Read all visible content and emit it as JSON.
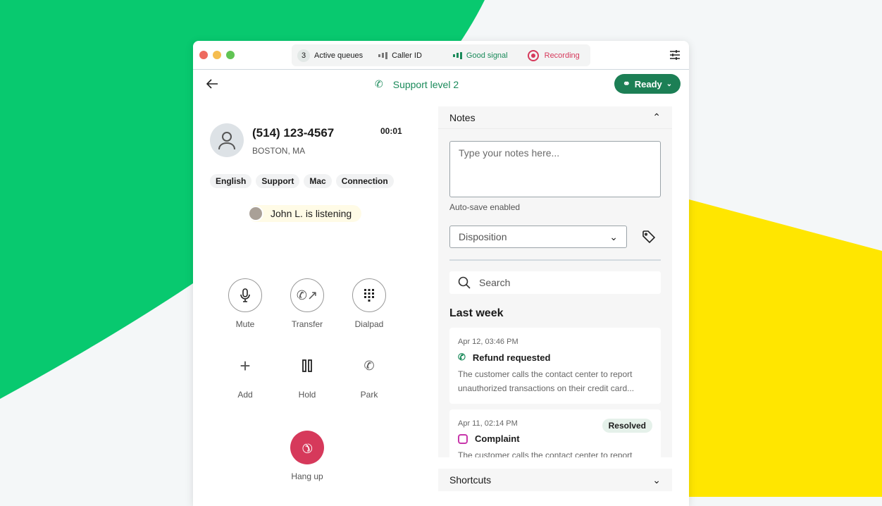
{
  "colors": {
    "brand_green": "#08c96f",
    "yellow": "#ffe600",
    "accent": "#1c7f55",
    "hangup": "#d6395b",
    "recording": "#d6395b"
  },
  "status_bar": {
    "queue_count": "3",
    "active_queues": "Active queues",
    "caller_id": "Caller ID",
    "signal": "Good signal",
    "recording": "Recording"
  },
  "header": {
    "queue_name": "Support level 2",
    "status": "Ready"
  },
  "caller": {
    "phone": "(514) 123-4567",
    "location": "BOSTON, MA",
    "timer": "00:01",
    "tags": [
      "English",
      "Support",
      "Mac",
      "Connection"
    ],
    "listener": "John L. is listening"
  },
  "controls": {
    "mute": "Mute",
    "transfer": "Transfer",
    "dialpad": "Dialpad",
    "add": "Add",
    "hold": "Hold",
    "park": "Park",
    "hangup": "Hang up"
  },
  "notes": {
    "title": "Notes",
    "placeholder": "Type your notes here...",
    "autosave": "Auto-save enabled",
    "disposition": "Disposition",
    "search_placeholder": "Search",
    "section": "Last week",
    "items": [
      {
        "date": "Apr 12, 03:46 PM",
        "title": "Refund requested",
        "text": "The customer calls the contact center to report unauthorized transactions on their credit card...",
        "channel": "phone-icon"
      },
      {
        "date": "Apr 11, 02:14 PM",
        "title": "Complaint",
        "badge": "Resolved",
        "text": "The customer calls the contact center to report",
        "channel": "instagram-icon"
      }
    ]
  },
  "shortcuts": {
    "title": "Shortcuts"
  }
}
